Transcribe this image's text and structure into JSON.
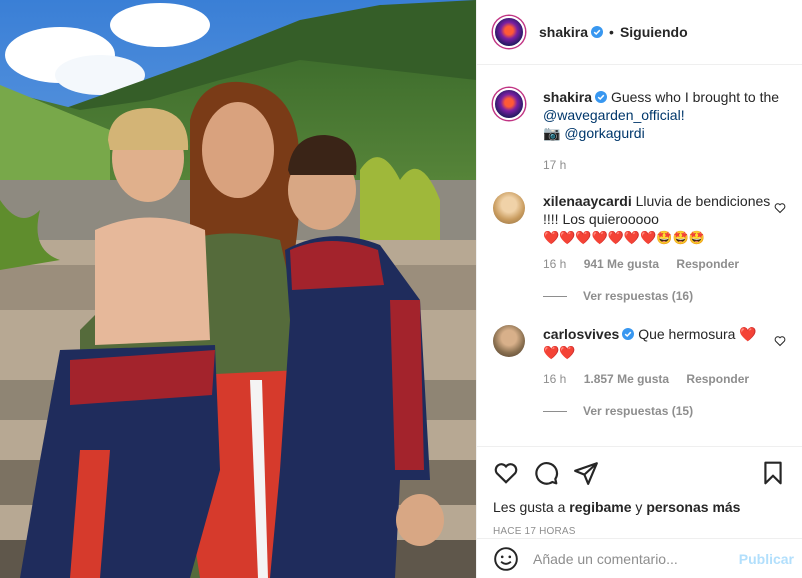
{
  "post": {
    "author": "shakira",
    "follow_status": "Siguiendo",
    "separator": "•"
  },
  "caption": {
    "author": "shakira",
    "text": "Guess who I brought to the",
    "mention1": "@wavegarden_official!",
    "camera_emoji": "📷",
    "mention2": "@gorkagurdi",
    "time": "17 h"
  },
  "comments": [
    {
      "user": "xilenaaycardi",
      "text": "Lluvia de bendiciones !!!! Los quierooooo",
      "emojis": "❤️❤️❤️❤️❤️❤️❤️🤩🤩🤩",
      "time": "16 h",
      "likes": "941 Me gusta",
      "reply": "Responder",
      "view_replies": "Ver respuestas (16)"
    },
    {
      "user": "carlosvives",
      "text": "Que hermosura",
      "emojis_inline": "❤️",
      "emojis": "❤️❤️",
      "time": "16 h",
      "likes": "1.857 Me gusta",
      "reply": "Responder",
      "view_replies": "Ver respuestas (15)"
    }
  ],
  "likes": {
    "prefix": "Les gusta a",
    "user": "regibame",
    "joiner": "y",
    "others": "personas más"
  },
  "timestamp": "HACE 17 HORAS",
  "composer": {
    "placeholder": "Añade un comentario...",
    "post": "Publicar"
  },
  "icons": {
    "like": "heart-icon",
    "comment": "comment-icon",
    "share": "paper-plane-icon",
    "save": "bookmark-icon",
    "emoji": "smiley-icon",
    "verified": "verified-badge-icon"
  },
  "colors": {
    "link": "#00376b",
    "muted": "#8e8e8e",
    "verified": "#3897f0",
    "post_disabled": "#b2dffc"
  }
}
